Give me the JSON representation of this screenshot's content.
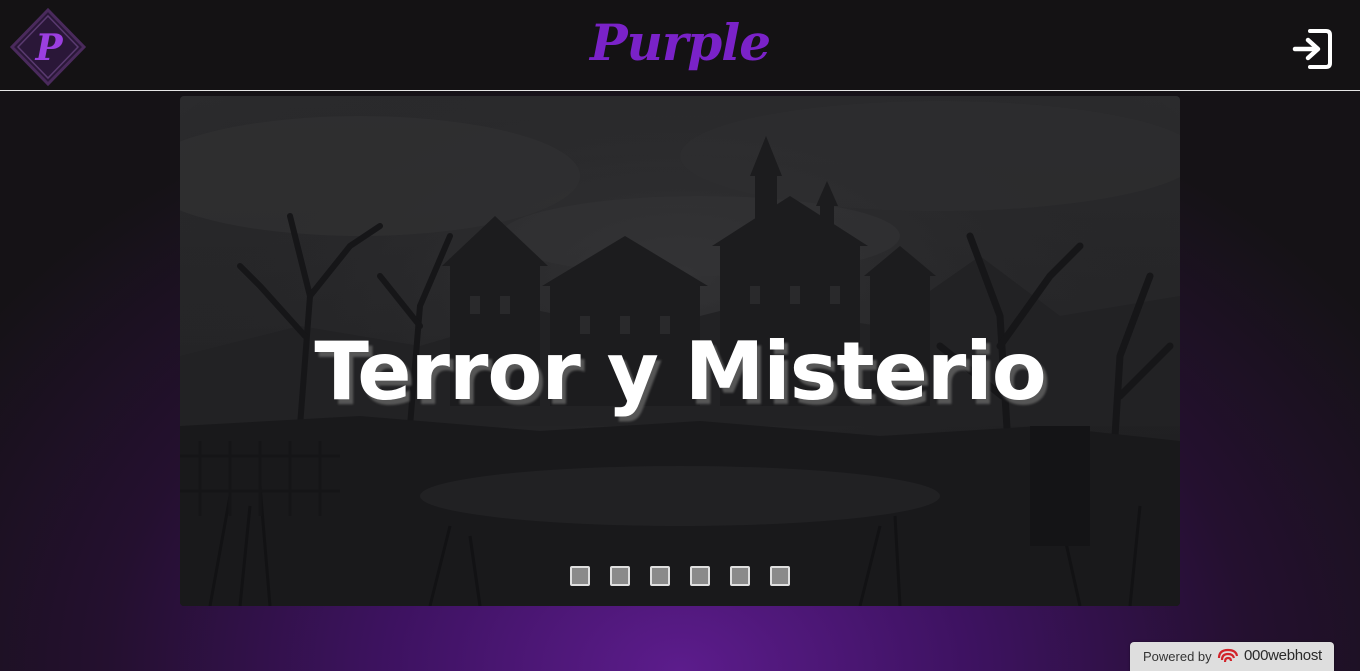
{
  "header": {
    "logo_letter": "P",
    "brand": "Purple",
    "login_icon": "sign-in-icon"
  },
  "slider": {
    "title": "Terror y Misterio",
    "slide_count": 6,
    "active_index": 0
  },
  "footer": {
    "powered_label": "Powered by",
    "powered_brand": "000webhost",
    "powered_icon": "000webhost-logo-icon"
  },
  "colors": {
    "accent": "#7a22c8",
    "header_bg": "#141214",
    "page_glow": "#5c1c8c"
  }
}
